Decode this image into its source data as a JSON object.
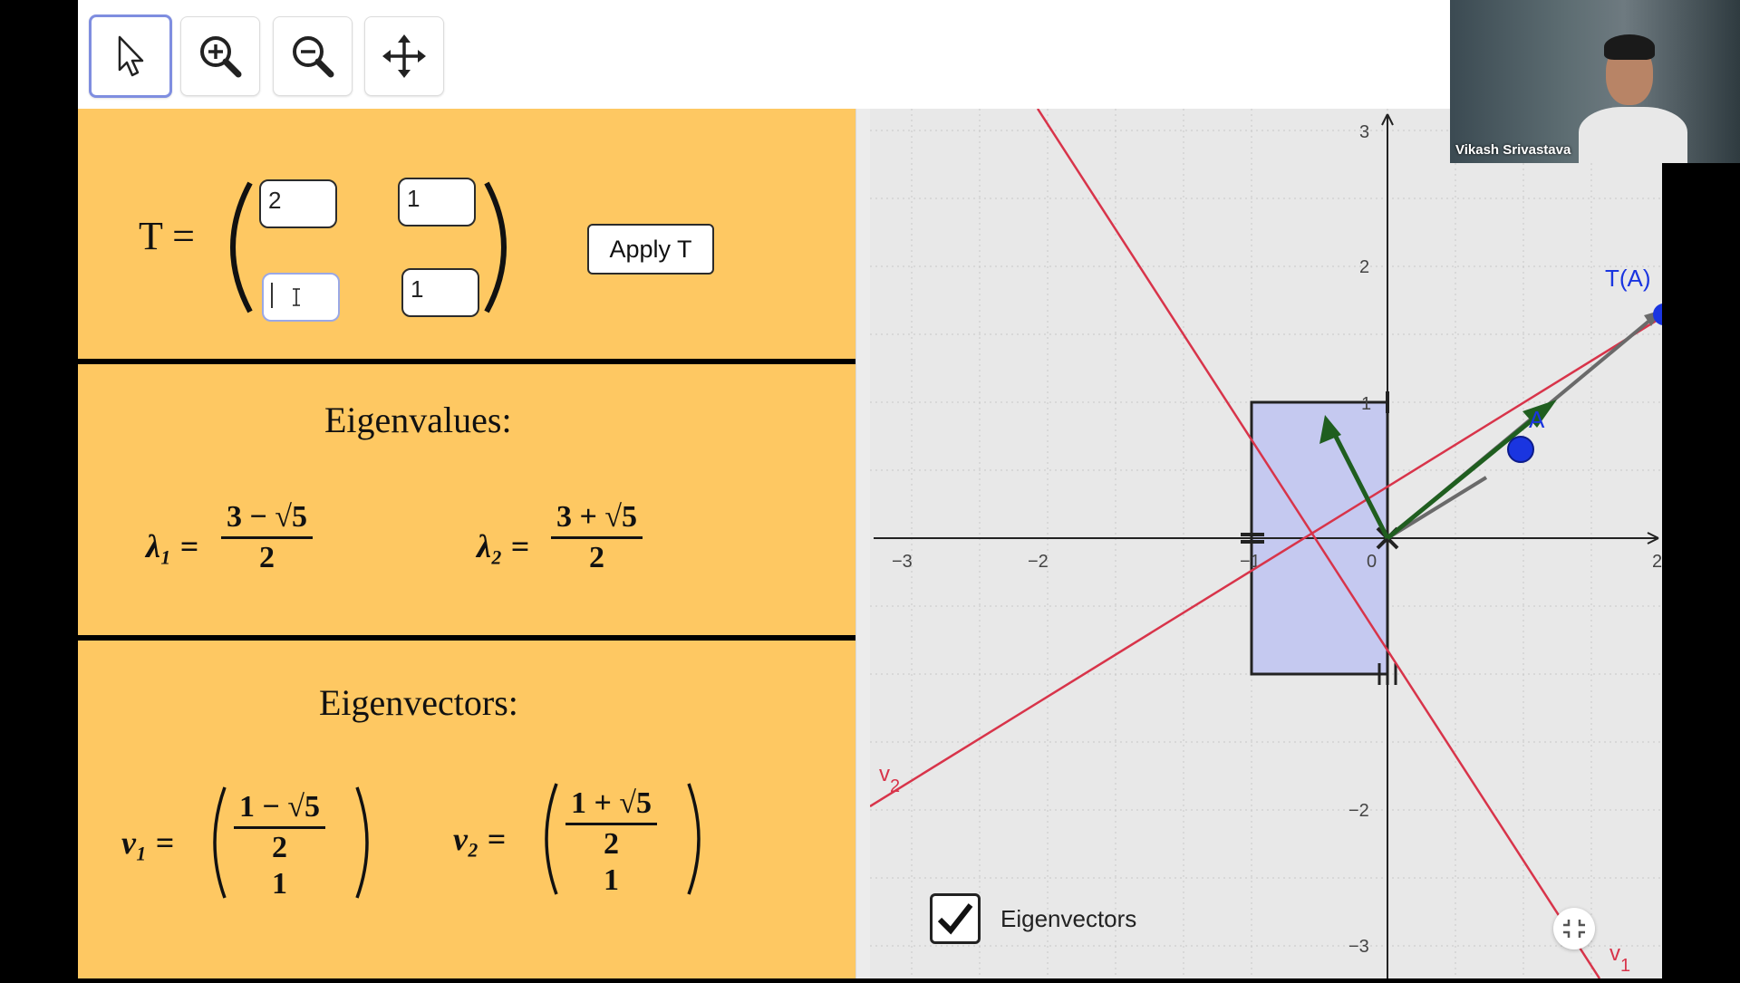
{
  "toolbar": {
    "tools": [
      {
        "name": "move-pointer",
        "icon": "arrow-pointer-icon",
        "active": true
      },
      {
        "name": "zoom-in",
        "icon": "zoom-in-icon"
      },
      {
        "name": "zoom-out",
        "icon": "zoom-out-icon"
      },
      {
        "name": "move-graphics-view",
        "icon": "move-arrows-icon"
      }
    ]
  },
  "matrix": {
    "label": "T =",
    "entries": [
      "2",
      "1",
      "",
      "1"
    ],
    "apply_label": "Apply T"
  },
  "eigenvalues": {
    "heading": "Eigenvalues:",
    "lambda1_label": "λ₁ =",
    "lambda1_num": "3 − √5",
    "lambda1_den": "2",
    "lambda2_label": "λ₂ =",
    "lambda2_num": "3 + √5",
    "lambda2_den": "2"
  },
  "eigenvectors": {
    "heading": "Eigenvectors:",
    "v1_label": "v₁ =",
    "v1_num": "1 − √5",
    "v1_den": "2",
    "v1_second": "1",
    "v2_label": "v₂ =",
    "v2_num": "1 + √5",
    "v2_den": "2",
    "v2_second": "1"
  },
  "graph": {
    "x_ticks": [
      "−3",
      "−2",
      "−1",
      "0",
      "2"
    ],
    "y_ticks": [
      "3",
      "2",
      "1",
      "−2",
      "−3"
    ],
    "point_A_label": "A",
    "point_TA_label": "T(A)",
    "line_v1_label": "v",
    "line_v1_sub": "1",
    "line_v2_label": "v",
    "line_v2_sub": "2",
    "checkbox_label": "Eigenvectors",
    "checkbox_checked": true,
    "colors": {
      "square_fill": "#c5c9f0",
      "line": "#d8344a",
      "eigen_arrow": "#1f5e1f",
      "point": "#1a35e0"
    }
  },
  "webcam": {
    "participant_name": "Vikash Srivastava"
  }
}
